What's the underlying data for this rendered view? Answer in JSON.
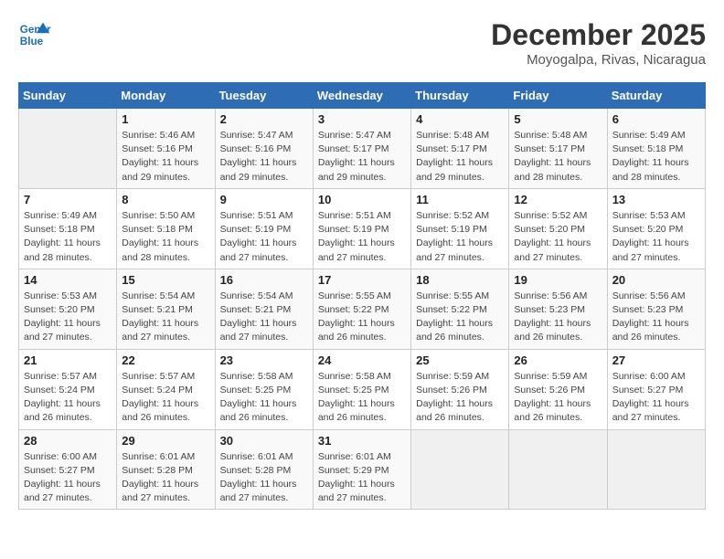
{
  "logo": {
    "line1": "General",
    "line2": "Blue"
  },
  "title": {
    "month_year": "December 2025",
    "location": "Moyogalpa, Rivas, Nicaragua"
  },
  "days_of_week": [
    "Sunday",
    "Monday",
    "Tuesday",
    "Wednesday",
    "Thursday",
    "Friday",
    "Saturday"
  ],
  "weeks": [
    [
      {
        "day": "",
        "sunrise": "",
        "sunset": "",
        "daylight": "",
        "empty": true
      },
      {
        "day": "1",
        "sunrise": "Sunrise: 5:46 AM",
        "sunset": "Sunset: 5:16 PM",
        "daylight": "Daylight: 11 hours and 29 minutes."
      },
      {
        "day": "2",
        "sunrise": "Sunrise: 5:47 AM",
        "sunset": "Sunset: 5:16 PM",
        "daylight": "Daylight: 11 hours and 29 minutes."
      },
      {
        "day": "3",
        "sunrise": "Sunrise: 5:47 AM",
        "sunset": "Sunset: 5:17 PM",
        "daylight": "Daylight: 11 hours and 29 minutes."
      },
      {
        "day": "4",
        "sunrise": "Sunrise: 5:48 AM",
        "sunset": "Sunset: 5:17 PM",
        "daylight": "Daylight: 11 hours and 29 minutes."
      },
      {
        "day": "5",
        "sunrise": "Sunrise: 5:48 AM",
        "sunset": "Sunset: 5:17 PM",
        "daylight": "Daylight: 11 hours and 28 minutes."
      },
      {
        "day": "6",
        "sunrise": "Sunrise: 5:49 AM",
        "sunset": "Sunset: 5:18 PM",
        "daylight": "Daylight: 11 hours and 28 minutes."
      }
    ],
    [
      {
        "day": "7",
        "sunrise": "Sunrise: 5:49 AM",
        "sunset": "Sunset: 5:18 PM",
        "daylight": "Daylight: 11 hours and 28 minutes."
      },
      {
        "day": "8",
        "sunrise": "Sunrise: 5:50 AM",
        "sunset": "Sunset: 5:18 PM",
        "daylight": "Daylight: 11 hours and 28 minutes."
      },
      {
        "day": "9",
        "sunrise": "Sunrise: 5:51 AM",
        "sunset": "Sunset: 5:19 PM",
        "daylight": "Daylight: 11 hours and 27 minutes."
      },
      {
        "day": "10",
        "sunrise": "Sunrise: 5:51 AM",
        "sunset": "Sunset: 5:19 PM",
        "daylight": "Daylight: 11 hours and 27 minutes."
      },
      {
        "day": "11",
        "sunrise": "Sunrise: 5:52 AM",
        "sunset": "Sunset: 5:19 PM",
        "daylight": "Daylight: 11 hours and 27 minutes."
      },
      {
        "day": "12",
        "sunrise": "Sunrise: 5:52 AM",
        "sunset": "Sunset: 5:20 PM",
        "daylight": "Daylight: 11 hours and 27 minutes."
      },
      {
        "day": "13",
        "sunrise": "Sunrise: 5:53 AM",
        "sunset": "Sunset: 5:20 PM",
        "daylight": "Daylight: 11 hours and 27 minutes."
      }
    ],
    [
      {
        "day": "14",
        "sunrise": "Sunrise: 5:53 AM",
        "sunset": "Sunset: 5:20 PM",
        "daylight": "Daylight: 11 hours and 27 minutes."
      },
      {
        "day": "15",
        "sunrise": "Sunrise: 5:54 AM",
        "sunset": "Sunset: 5:21 PM",
        "daylight": "Daylight: 11 hours and 27 minutes."
      },
      {
        "day": "16",
        "sunrise": "Sunrise: 5:54 AM",
        "sunset": "Sunset: 5:21 PM",
        "daylight": "Daylight: 11 hours and 27 minutes."
      },
      {
        "day": "17",
        "sunrise": "Sunrise: 5:55 AM",
        "sunset": "Sunset: 5:22 PM",
        "daylight": "Daylight: 11 hours and 26 minutes."
      },
      {
        "day": "18",
        "sunrise": "Sunrise: 5:55 AM",
        "sunset": "Sunset: 5:22 PM",
        "daylight": "Daylight: 11 hours and 26 minutes."
      },
      {
        "day": "19",
        "sunrise": "Sunrise: 5:56 AM",
        "sunset": "Sunset: 5:23 PM",
        "daylight": "Daylight: 11 hours and 26 minutes."
      },
      {
        "day": "20",
        "sunrise": "Sunrise: 5:56 AM",
        "sunset": "Sunset: 5:23 PM",
        "daylight": "Daylight: 11 hours and 26 minutes."
      }
    ],
    [
      {
        "day": "21",
        "sunrise": "Sunrise: 5:57 AM",
        "sunset": "Sunset: 5:24 PM",
        "daylight": "Daylight: 11 hours and 26 minutes."
      },
      {
        "day": "22",
        "sunrise": "Sunrise: 5:57 AM",
        "sunset": "Sunset: 5:24 PM",
        "daylight": "Daylight: 11 hours and 26 minutes."
      },
      {
        "day": "23",
        "sunrise": "Sunrise: 5:58 AM",
        "sunset": "Sunset: 5:25 PM",
        "daylight": "Daylight: 11 hours and 26 minutes."
      },
      {
        "day": "24",
        "sunrise": "Sunrise: 5:58 AM",
        "sunset": "Sunset: 5:25 PM",
        "daylight": "Daylight: 11 hours and 26 minutes."
      },
      {
        "day": "25",
        "sunrise": "Sunrise: 5:59 AM",
        "sunset": "Sunset: 5:26 PM",
        "daylight": "Daylight: 11 hours and 26 minutes."
      },
      {
        "day": "26",
        "sunrise": "Sunrise: 5:59 AM",
        "sunset": "Sunset: 5:26 PM",
        "daylight": "Daylight: 11 hours and 26 minutes."
      },
      {
        "day": "27",
        "sunrise": "Sunrise: 6:00 AM",
        "sunset": "Sunset: 5:27 PM",
        "daylight": "Daylight: 11 hours and 27 minutes."
      }
    ],
    [
      {
        "day": "28",
        "sunrise": "Sunrise: 6:00 AM",
        "sunset": "Sunset: 5:27 PM",
        "daylight": "Daylight: 11 hours and 27 minutes."
      },
      {
        "day": "29",
        "sunrise": "Sunrise: 6:01 AM",
        "sunset": "Sunset: 5:28 PM",
        "daylight": "Daylight: 11 hours and 27 minutes."
      },
      {
        "day": "30",
        "sunrise": "Sunrise: 6:01 AM",
        "sunset": "Sunset: 5:28 PM",
        "daylight": "Daylight: 11 hours and 27 minutes."
      },
      {
        "day": "31",
        "sunrise": "Sunrise: 6:01 AM",
        "sunset": "Sunset: 5:29 PM",
        "daylight": "Daylight: 11 hours and 27 minutes."
      },
      {
        "day": "",
        "sunrise": "",
        "sunset": "",
        "daylight": "",
        "empty": true
      },
      {
        "day": "",
        "sunrise": "",
        "sunset": "",
        "daylight": "",
        "empty": true
      },
      {
        "day": "",
        "sunrise": "",
        "sunset": "",
        "daylight": "",
        "empty": true
      }
    ]
  ]
}
